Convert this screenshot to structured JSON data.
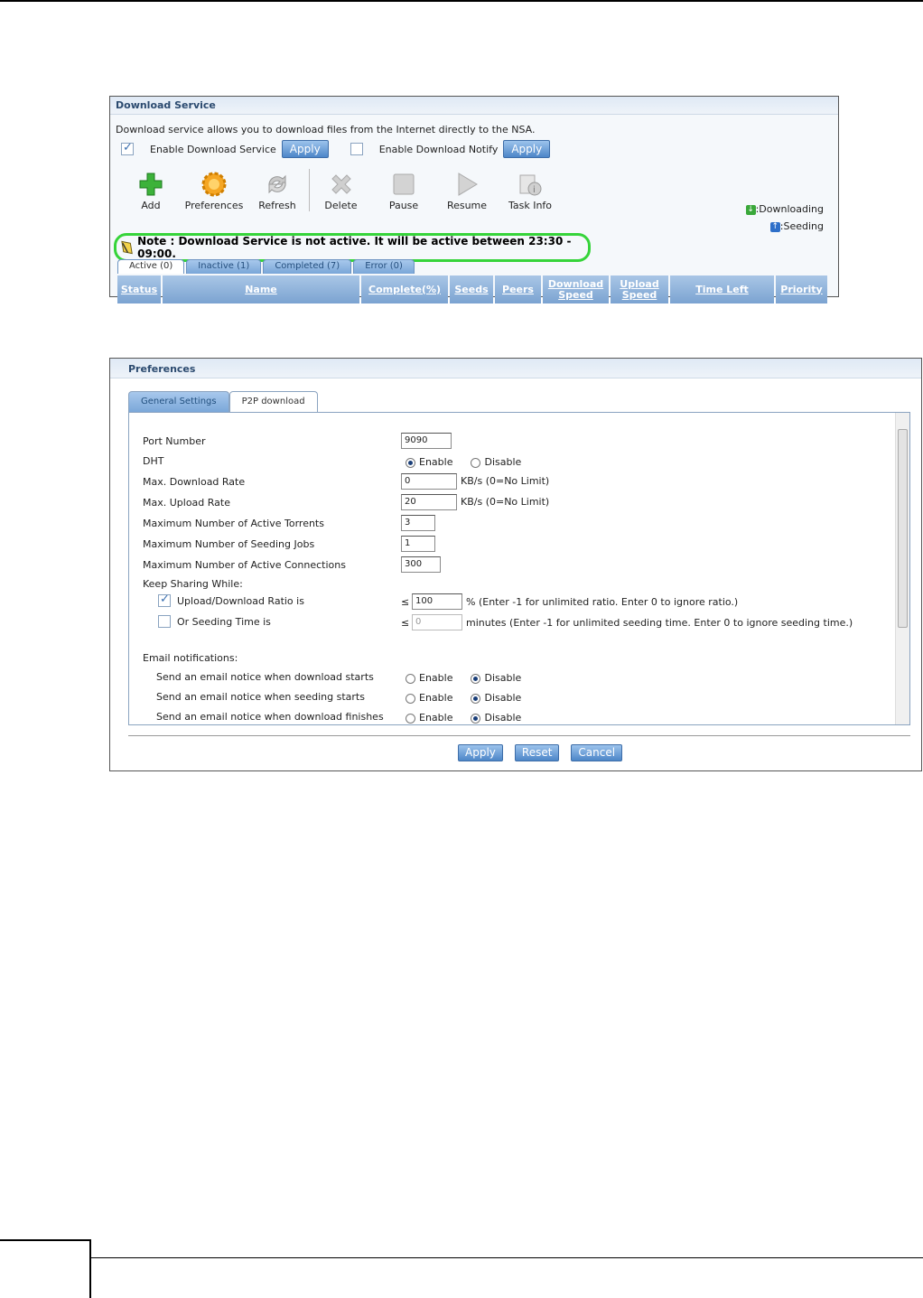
{
  "download_service": {
    "title": "Download Service",
    "description": "Download service allows you to download files from the Internet directly to the NSA.",
    "enable_service_label": "Enable Download Service",
    "enable_notify_label": "Enable Download Notify",
    "apply_label": "Apply",
    "toolbar": [
      {
        "label": "Add",
        "icon": "add-icon"
      },
      {
        "label": "Preferences",
        "icon": "preferences-icon"
      },
      {
        "label": "Refresh",
        "icon": "refresh-icon"
      },
      {
        "label": "Delete",
        "icon": "delete-icon"
      },
      {
        "label": "Pause",
        "icon": "pause-icon"
      },
      {
        "label": "Resume",
        "icon": "resume-icon"
      },
      {
        "label": "Task Info",
        "icon": "task-info-icon"
      }
    ],
    "legend": {
      "downloading": ":Downloading",
      "seeding": ":Seeding"
    },
    "note": "Note : Download Service is not active. It will be active between 23:30 - 09:00.",
    "tabs": [
      "Active (0)",
      "Inactive (1)",
      "Completed (7)",
      "Error (0)"
    ],
    "columns": [
      "Status",
      "Name",
      "Complete(%)",
      "Seeds",
      "Peers",
      "Download Speed",
      "Upload Speed",
      "Time Left",
      "Priority"
    ]
  },
  "preferences": {
    "title": "Preferences",
    "tabs": [
      "General Settings",
      "P2P download"
    ],
    "port_number": {
      "label": "Port Number",
      "value": "9090"
    },
    "dht": {
      "label": "DHT",
      "enable": "Enable",
      "disable": "Disable"
    },
    "max_download": {
      "label": "Max. Download Rate",
      "value": "0",
      "unit": "KB/s (0=No Limit)"
    },
    "max_upload": {
      "label": "Max. Upload Rate",
      "value": "20",
      "unit": "KB/s (0=No Limit)"
    },
    "active_torrents": {
      "label": "Maximum Number of Active Torrents",
      "value": "3"
    },
    "seeding_jobs": {
      "label": "Maximum Number of Seeding Jobs",
      "value": "1"
    },
    "active_connections": {
      "label": "Maximum Number of Active Connections",
      "value": "300"
    },
    "keep_sharing": "Keep Sharing While:",
    "ratio": {
      "label": "Upload/Download Ratio is",
      "sign": "≤",
      "value": "100",
      "hint": "% (Enter -1 for unlimited ratio. Enter 0 to ignore ratio.)"
    },
    "seeding_time": {
      "label": "Or Seeding Time is",
      "sign": "≤",
      "value": "0",
      "hint": "minutes (Enter -1 for unlimited seeding time. Enter 0 to ignore seeding time.)"
    },
    "email_title": "Email notifications:",
    "emails": [
      {
        "label": "Send an email notice when download starts"
      },
      {
        "label": "Send an email notice when seeding starts"
      },
      {
        "label": "Send an email notice when download finishes"
      }
    ],
    "enable": "Enable",
    "disable": "Disable",
    "buttons": {
      "apply": "Apply",
      "reset": "Reset",
      "cancel": "Cancel"
    }
  }
}
